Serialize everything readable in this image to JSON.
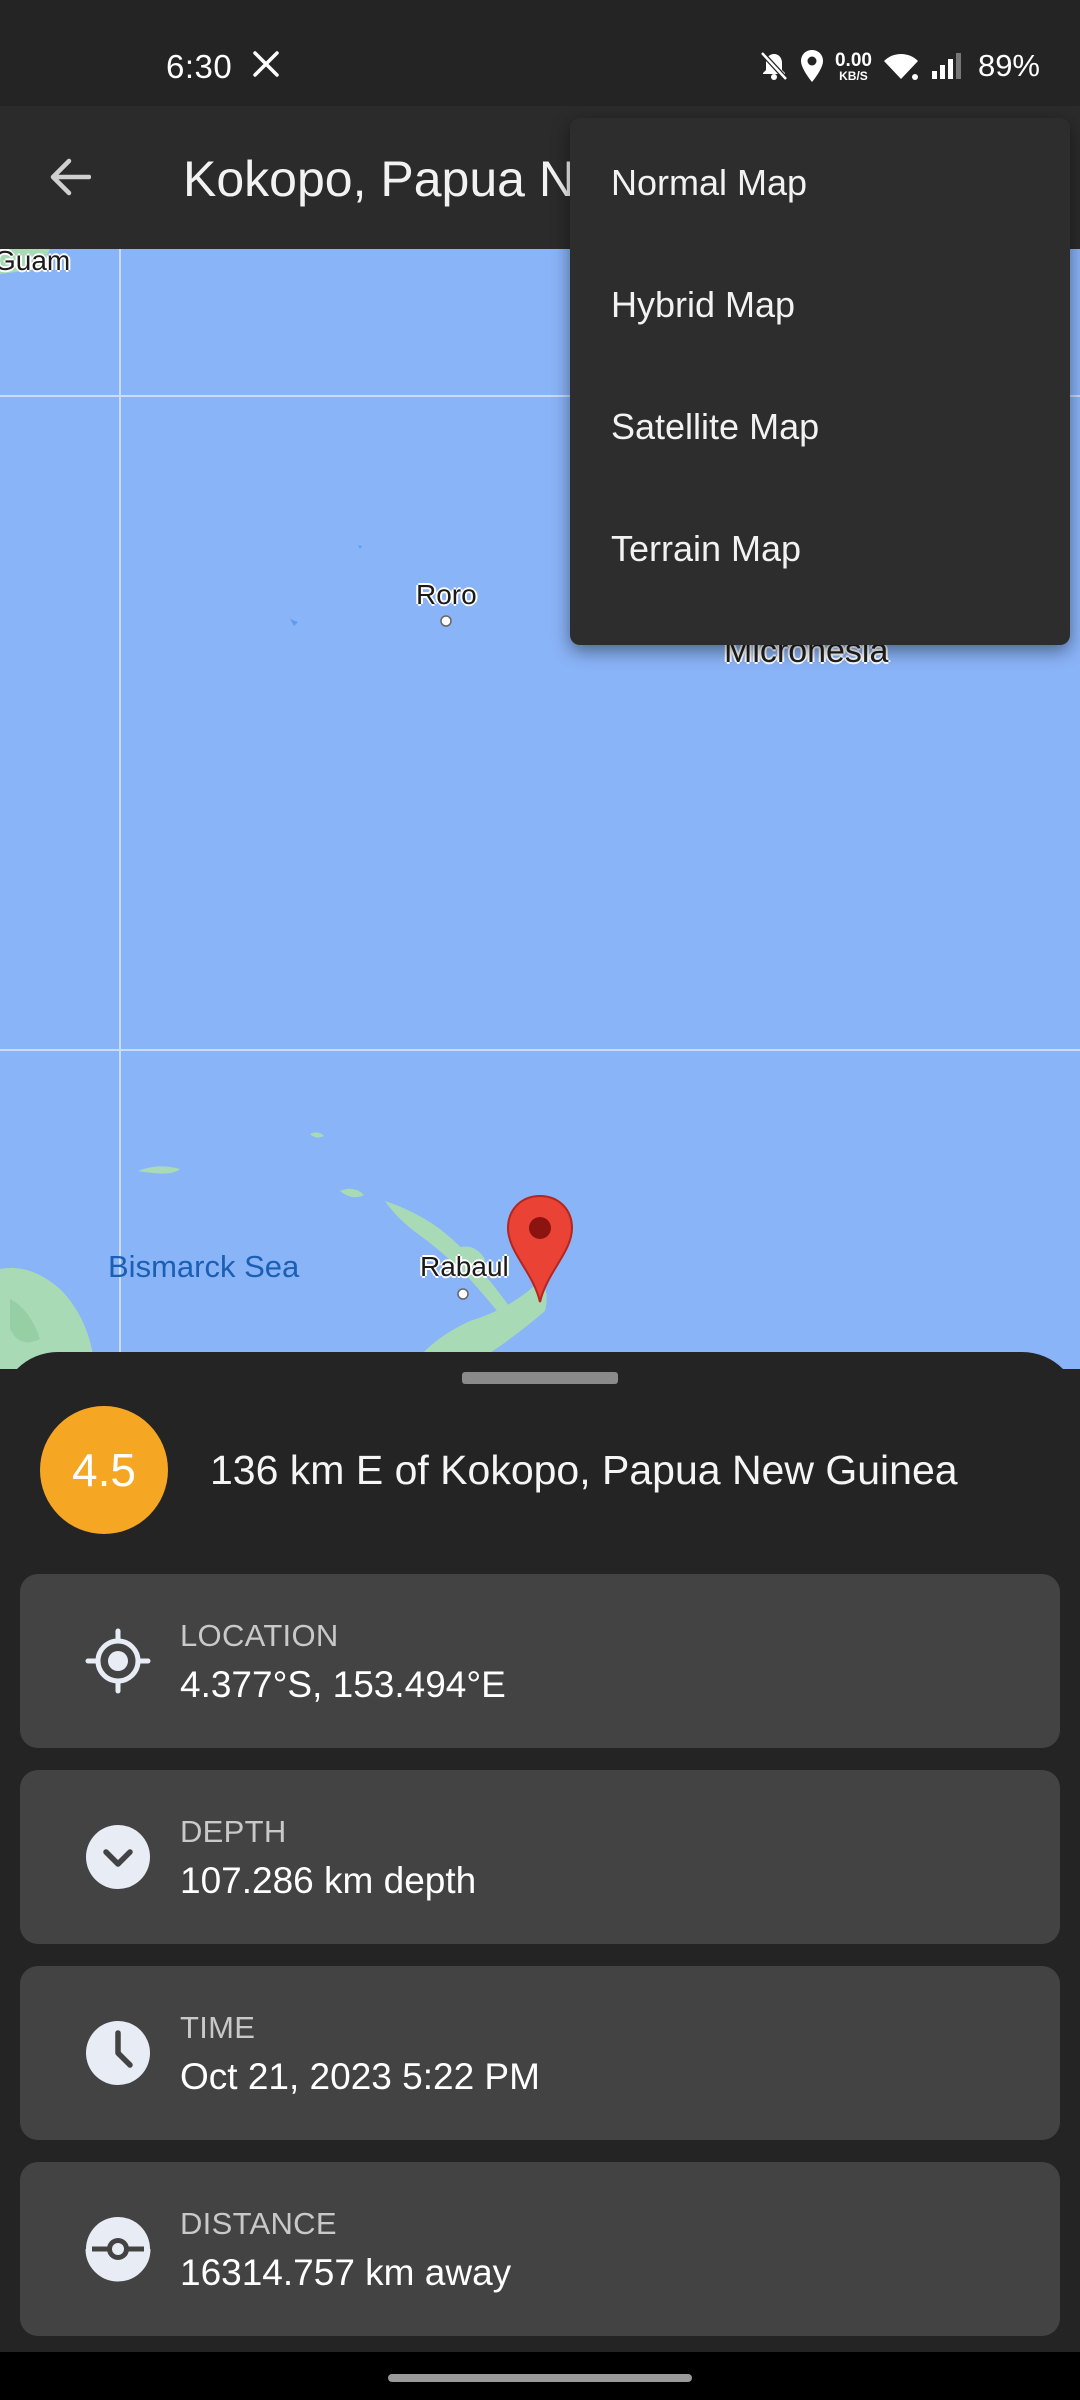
{
  "status_bar": {
    "time": "6:30",
    "data_rate_value": "0.00",
    "data_rate_unit": "KB/S",
    "battery": "89%",
    "icons": [
      "x-icon",
      "notifications-off-icon",
      "location-icon",
      "wifi-icon",
      "signal-icon"
    ]
  },
  "app_bar": {
    "title": "Kokopo, Papua N",
    "back_icon": "back-arrow-icon"
  },
  "map": {
    "labels": {
      "guam": "Guam",
      "roro": "Roro",
      "micronesia": "Micronesia",
      "bismarck_sea": "Bismarck Sea",
      "rabaul": "Rabaul"
    },
    "marker_icon": "map-pin-icon",
    "colors": {
      "water": "#8ab4f8",
      "land": "#a8dab5",
      "pin": "#ea4335"
    }
  },
  "menu": {
    "items": [
      {
        "label": "Normal Map"
      },
      {
        "label": "Hybrid Map"
      },
      {
        "label": "Satellite Map"
      },
      {
        "label": "Terrain Map"
      }
    ]
  },
  "sheet": {
    "magnitude": "4.5",
    "magnitude_color": "#f5a623",
    "place": "136 km E of Kokopo, Papua New Guinea",
    "details": [
      {
        "label": "LOCATION",
        "value": "4.377°S, 153.494°E",
        "icon": "location-target-icon"
      },
      {
        "label": "DEPTH",
        "value": "107.286 km depth",
        "icon": "chevron-down-circle-icon"
      },
      {
        "label": "TIME",
        "value": "Oct 21, 2023 5:22 PM",
        "icon": "clock-icon"
      },
      {
        "label": "DISTANCE",
        "value": "16314.757 km away",
        "icon": "compass-icon"
      }
    ]
  }
}
